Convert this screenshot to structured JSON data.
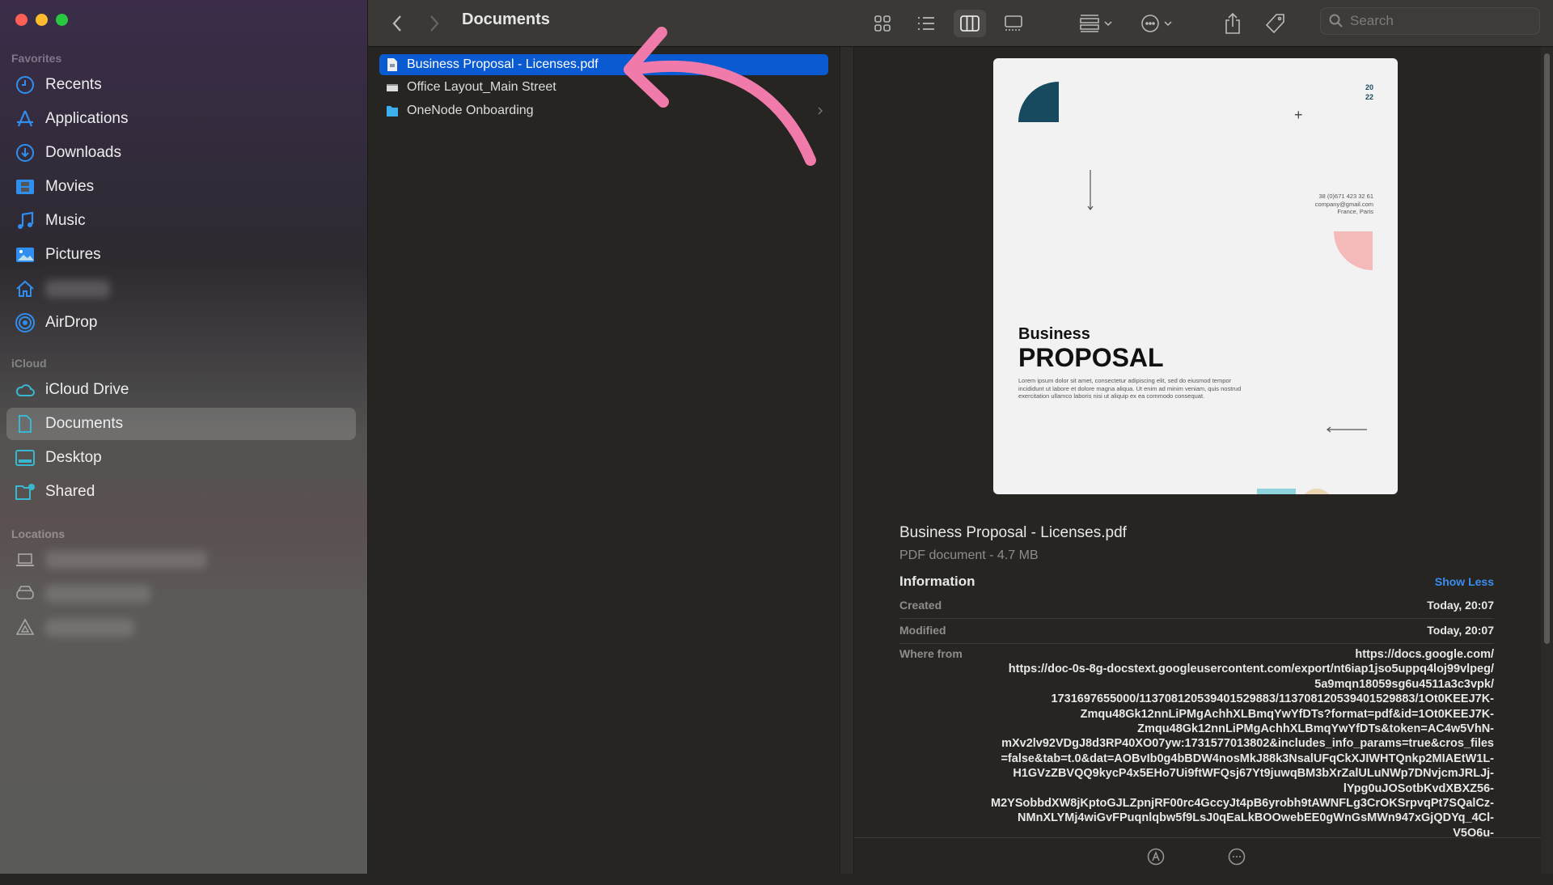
{
  "window": {
    "title": "Documents"
  },
  "sidebar": {
    "sections": {
      "favorites": "Favorites",
      "icloud": "iCloud",
      "locations": "Locations"
    },
    "favorites": [
      {
        "label": "Recents",
        "icon": "clock-icon"
      },
      {
        "label": "Applications",
        "icon": "applications-icon"
      },
      {
        "label": "Downloads",
        "icon": "download-icon"
      },
      {
        "label": "Movies",
        "icon": "film-icon"
      },
      {
        "label": "Music",
        "icon": "music-note-icon"
      },
      {
        "label": "Pictures",
        "icon": "picture-icon"
      },
      {
        "label": "",
        "icon": "home-icon"
      },
      {
        "label": "AirDrop",
        "icon": "airdrop-icon"
      }
    ],
    "icloud": [
      {
        "label": "iCloud Drive",
        "icon": "cloud-icon"
      },
      {
        "label": "Documents",
        "icon": "document-icon",
        "selected": true
      },
      {
        "label": "Desktop",
        "icon": "desktop-icon"
      },
      {
        "label": "Shared",
        "icon": "shared-folder-icon"
      }
    ],
    "locations": [
      {
        "icon": "laptop-icon"
      },
      {
        "icon": "drive-icon"
      },
      {
        "icon": "google-drive-icon"
      }
    ]
  },
  "toolbar": {
    "search_placeholder": "Search",
    "view_mode": "columns"
  },
  "files": [
    {
      "name": "Business Proposal - Licenses.pdf",
      "type": "pdf",
      "selected": true
    },
    {
      "name": "Office Layout_Main Street",
      "type": "image"
    },
    {
      "name": "OneNode Onboarding",
      "type": "folder"
    }
  ],
  "preview": {
    "document": {
      "year_top": "20",
      "year_bottom": "22",
      "contact": [
        "38 (0)671 423 32 61",
        "company@gmail.com",
        "France, Paris"
      ],
      "heading_small": "Business",
      "heading_large": "PROPOSAL",
      "body": "Lorem ipsum dolor sit amet, consectetur adipiscing elit, sed do eiusmod tempor incididunt ut labore et dolore magna aliqua. Ut enim ad minim veniam, quis nostrud exercitation ullamco laboris nisi ut aliquip ex ea commodo consequat."
    },
    "file_name": "Business Proposal - Licenses.pdf",
    "kind_size": "PDF document - 4.7 MB",
    "info_heading": "Information",
    "show_less": "Show Less",
    "created_label": "Created",
    "created": "Today, 20:07",
    "modified_label": "Modified",
    "modified": "Today, 20:07",
    "where_from_label": "Where from",
    "where_from": [
      "https://docs.google.com/",
      "https://doc-0s-8g-docstext.googleusercontent.com/export/nt6iap1jso5uppq4loj99vlpeg/",
      "5a9mqn18059sg6u4511a3c3vpk/",
      "1731697655000/113708120539401529883/113708120539401529883/1Ot0KEEJ7K-",
      "Zmqu48Gk12nnLiPMgAchhXLBmqYwYfDTs?format=pdf&id=1Ot0KEEJ7K-",
      "Zmqu48Gk12nnLiPMgAchhXLBmqYwYfDTs&token=AC4w5VhN-",
      "mXv2lv92VDgJ8d3RP40XO07yw:1731577013802&includes_info_params=true&cros_files",
      "=false&tab=t.0&dat=AOBvIb0g4bBDW4nosMkJ88k3NsalUFqCkXJIWHTQnkp2MIAEtW1L-",
      "H1GVzZBVQQ9kycP4x5EHo7Ui9ftWFQsj67Yt9juwqBM3bXrZalULuNWp7DNvjcmJRLJj-",
      "lYpg0uJOSotbKvdXBXZ56-",
      "M2YSobbdXW8jKptoGJLZpnjRF00rc4GccyJt4pB6yrobh9tAWNFLg3CrOKSrpvqPt7SQalCz-",
      "NMnXLYMj4wiGvFPuqnlqbw5f9LsJ0qEaLkBOOwebEE0gWnGsMWn947xGjQDYq_4Cl-",
      "V5O6u-"
    ]
  },
  "colors": {
    "accent": "#0a5bd1",
    "sidebar_icon": "#2f8ff0",
    "icloud_icon": "#37b8d0",
    "annotation_arrow": "#f07aaa",
    "link": "#3a8ef0"
  }
}
